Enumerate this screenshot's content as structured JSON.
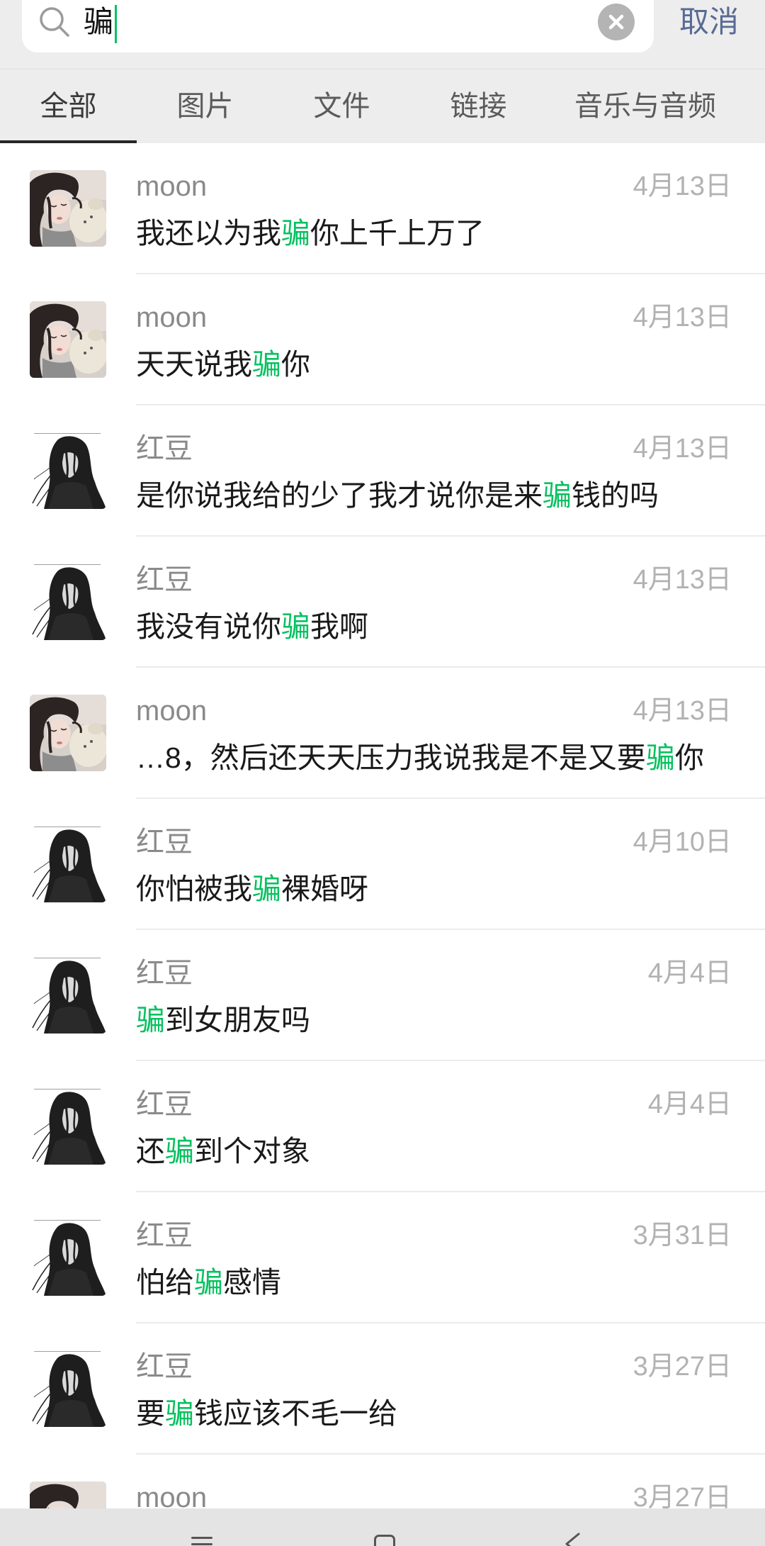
{
  "search": {
    "query": "骗",
    "cancel_label": "取消",
    "search_icon": "search-icon",
    "clear_icon": "clear-icon"
  },
  "tabs": [
    {
      "label": "全部",
      "active": true
    },
    {
      "label": "图片",
      "active": false
    },
    {
      "label": "文件",
      "active": false
    },
    {
      "label": "链接",
      "active": false
    },
    {
      "label": "音乐与音频",
      "active": false
    }
  ],
  "highlight_color": "#07c160",
  "link_color": "#576b95",
  "results": [
    {
      "avatar": "girl-photo-avatar",
      "name": "moon",
      "date": "4月13日",
      "before": "我还以为我",
      "match": "骗",
      "after": "你上千上万了"
    },
    {
      "avatar": "girl-photo-avatar",
      "name": "moon",
      "date": "4月13日",
      "before": "天天说我",
      "match": "骗",
      "after": "你"
    },
    {
      "avatar": "anime-portrait-avatar",
      "name": "红豆",
      "date": "4月13日",
      "before": "是你说我给的少了我才说你是来",
      "match": "骗",
      "after": "钱的吗"
    },
    {
      "avatar": "anime-portrait-avatar",
      "name": "红豆",
      "date": "4月13日",
      "before": "我没有说你",
      "match": "骗",
      "after": "我啊"
    },
    {
      "avatar": "girl-photo-avatar",
      "name": "moon",
      "date": "4月13日",
      "before": "…8，然后还天天压力我说我是不是又要",
      "match": "骗",
      "after": "你"
    },
    {
      "avatar": "anime-portrait-avatar",
      "name": "红豆",
      "date": "4月10日",
      "before": "你怕被我",
      "match": "骗",
      "after": "裸婚呀"
    },
    {
      "avatar": "anime-portrait-avatar",
      "name": "红豆",
      "date": "4月4日",
      "match": "骗",
      "after": "到女朋友吗"
    },
    {
      "avatar": "anime-portrait-avatar",
      "name": "红豆",
      "date": "4月4日",
      "before": "还",
      "match": "骗",
      "after": "到个对象"
    },
    {
      "avatar": "anime-portrait-avatar",
      "name": "红豆",
      "date": "3月31日",
      "before": "怕给",
      "match": "骗",
      "after": "感情"
    },
    {
      "avatar": "anime-portrait-avatar",
      "name": "红豆",
      "date": "3月27日",
      "before": "要",
      "match": "骗",
      "after": "钱应该不毛一给"
    },
    {
      "avatar": "girl-photo-avatar",
      "name": "moon",
      "date": "3月27日"
    }
  ],
  "nav_bar": {
    "icons": [
      "menu-icon",
      "home-icon",
      "back-icon"
    ]
  }
}
